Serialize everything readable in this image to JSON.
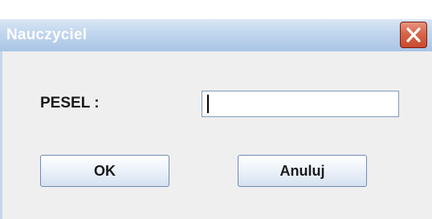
{
  "window": {
    "title": "Nauczyciel",
    "close_icon": "close-icon"
  },
  "form": {
    "pesel_label": "PESEL :",
    "pesel_value": "",
    "pesel_placeholder": ""
  },
  "buttons": {
    "ok_label": "OK",
    "cancel_label": "Anuluj"
  },
  "colors": {
    "title_gradient_start": "#d9e6f5",
    "title_gradient_end": "#a9c4e6",
    "close_button": "#d6654a",
    "dialog_background": "#efefef"
  }
}
